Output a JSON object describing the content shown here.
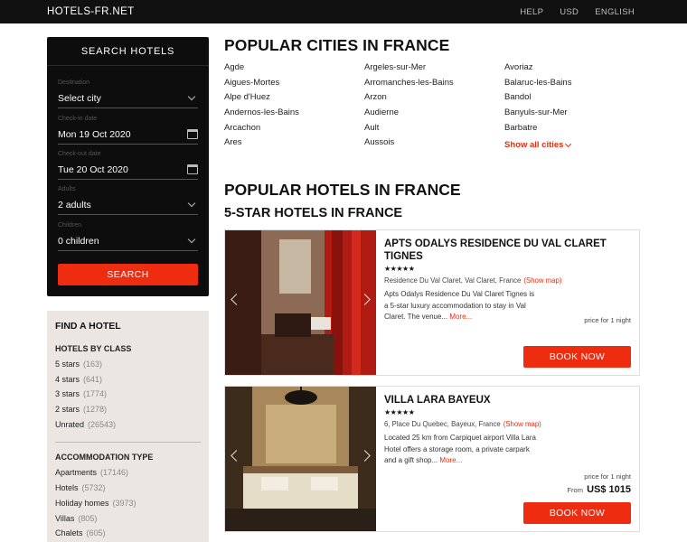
{
  "topbar": {
    "brand": "HOTELS-FR.NET",
    "links": [
      "HELP",
      "USD",
      "ENGLISH"
    ]
  },
  "search": {
    "title": "SEARCH HOTELS",
    "destination": {
      "label": "Destination",
      "value": "Select city"
    },
    "checkin": {
      "label": "Check-in date",
      "value": "Mon 19 Oct 2020"
    },
    "checkout": {
      "label": "Check-out date",
      "value": "Tue 20 Oct 2020"
    },
    "adults": {
      "label": "Adults",
      "value": "2 adults"
    },
    "children": {
      "label": "Children",
      "value": "0 children"
    },
    "button": "SEARCH"
  },
  "find": {
    "title": "FIND A HOTEL",
    "by_class_title": "HOTELS BY CLASS",
    "by_class": [
      {
        "label": "5 stars",
        "count": "(163)"
      },
      {
        "label": "4 stars",
        "count": "(641)"
      },
      {
        "label": "3 stars",
        "count": "(1774)"
      },
      {
        "label": "2 stars",
        "count": "(1278)"
      },
      {
        "label": "Unrated",
        "count": "(26543)"
      }
    ],
    "accommodation_title": "ACCOMMODATION TYPE",
    "accommodation": [
      {
        "label": "Apartments",
        "count": "(17146)"
      },
      {
        "label": "Hotels",
        "count": "(5732)"
      },
      {
        "label": "Holiday homes",
        "count": "(3973)"
      },
      {
        "label": "Villas",
        "count": "(805)"
      },
      {
        "label": "Chalets",
        "count": "(605)"
      }
    ]
  },
  "cities": {
    "title": "POPULAR CITIES IN FRANCE",
    "col1": [
      "Agde",
      "Aigues-Mortes",
      "Alpe d'Huez",
      "Andernos-les-Bains",
      "Arcachon",
      "Ares"
    ],
    "col2": [
      "Argeles-sur-Mer",
      "Arromanches-les-Bains",
      "Arzon",
      "Audierne",
      "Ault",
      "Aussois"
    ],
    "col3": [
      "Avoriaz",
      "Balaruc-les-Bains",
      "Bandol",
      "Banyuls-sur-Mer",
      "Barbatre"
    ],
    "show_all": "Show all cities"
  },
  "hotels": {
    "title": "POPULAR HOTELS IN FRANCE",
    "subtitle": "5-STAR HOTELS IN FRANCE",
    "items": [
      {
        "name": "APTS ODALYS RESIDENCE DU VAL CLARET TIGNES",
        "stars": "★★★★★",
        "address": "Residence Du Val Claret, Val Claret, France",
        "show_map": "(Show map)",
        "description": "Apts Odalys Residence Du Val Claret Tignes is a 5-star luxury accommodation to stay in Val Claret. The venue...",
        "more": "More...",
        "price_label": "price for 1 night",
        "button": "BOOK NOW"
      },
      {
        "name": "VILLA LARA BAYEUX",
        "stars": "★★★★★",
        "address": "6, Place Du Quebec, Bayeux, France",
        "show_map": "(Show map)",
        "description": "Located 25 km from Carpiquet airport Villa Lara Hotel offers a storage room, a private carpark and a gift shop...",
        "more": "More...",
        "price_label": "price for 1 night",
        "from": "From",
        "price": "US$ 1015",
        "button": "BOOK NOW"
      }
    ]
  }
}
